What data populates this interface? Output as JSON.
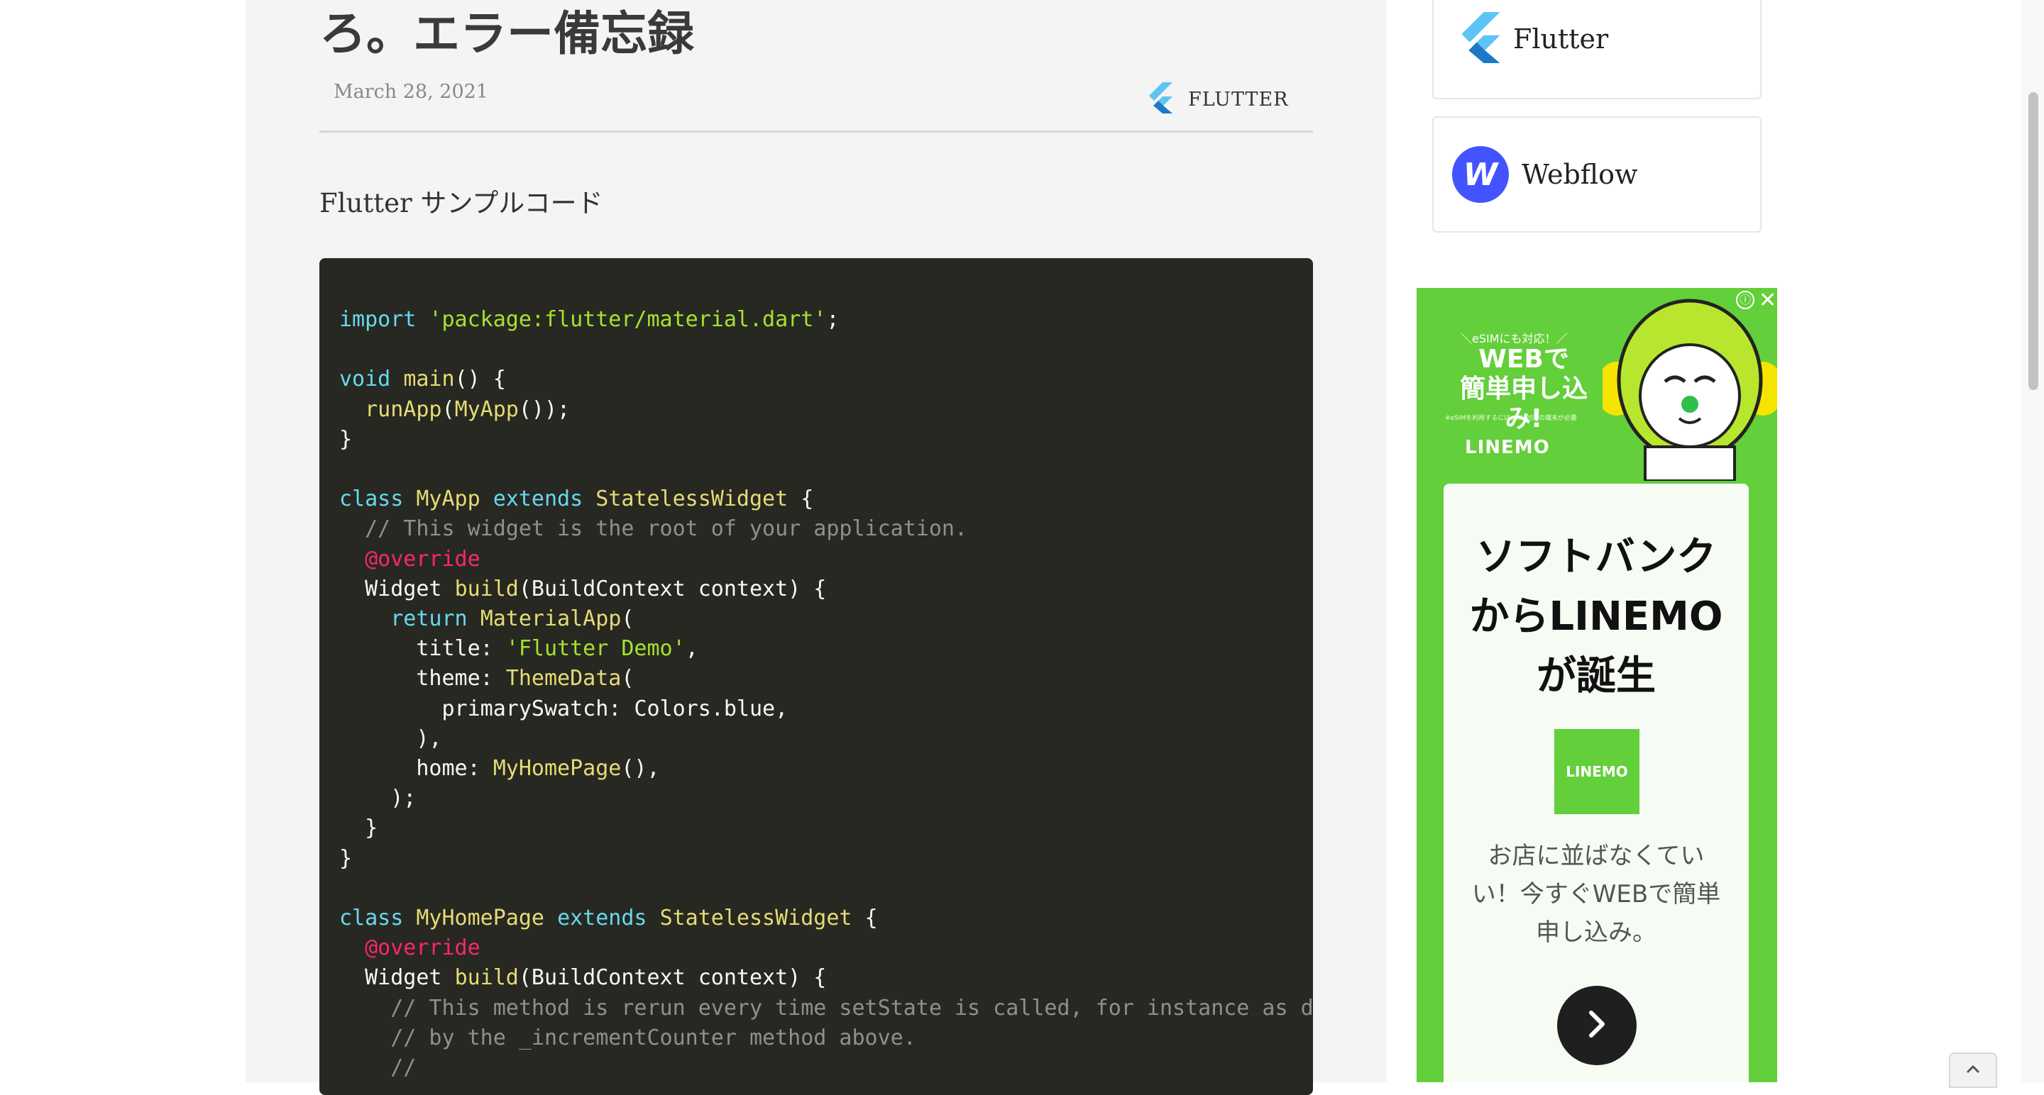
{
  "article": {
    "title": "ろ。エラー備忘録",
    "date": "March 28, 2021",
    "category": "FLUTTER",
    "intro": "Flutter サンプルコード"
  },
  "code": {
    "language": "dart",
    "lines": [
      "import 'package:flutter/material.dart';",
      "",
      "void main() {",
      "  runApp(MyApp());",
      "}",
      "",
      "class MyApp extends StatelessWidget {",
      "  // This widget is the root of your application.",
      "  @override",
      "  Widget build(BuildContext context) {",
      "    return MaterialApp(",
      "      title: 'Flutter Demo',",
      "      theme: ThemeData(",
      "        primarySwatch: Colors.blue,",
      "      ),",
      "      home: MyHomePage(),",
      "    );",
      "  }",
      "}",
      "",
      "class MyHomePage extends StatelessWidget {",
      "  @override",
      "  Widget build(BuildContext context) {",
      "    // This method is rerun every time setState is called, for instance as done",
      "    // by the _incrementCounter method above.",
      "    //"
    ]
  },
  "sidebar": {
    "items": [
      {
        "label": "Flutter",
        "icon": "flutter-icon"
      },
      {
        "label": "Webflow",
        "icon": "webflow-icon"
      }
    ]
  },
  "ad": {
    "kicker": "＼eSIMにも対応！／",
    "top_headline_1": "WEBで",
    "top_headline_2": "簡単申し込み!",
    "fine_print": "※eSIMを利用するにはeSIM対応の端末が必要",
    "brand": "LINEMO",
    "headline": "ソフトバンクからLINEMOが誕生",
    "logo_text": "LINEMO",
    "body": "お店に並ばなくていい！今すぐWEBで簡単申し込み。",
    "info": "ⓘ",
    "close": "✕"
  },
  "colors": {
    "code_bg": "#272822",
    "ad_green": "#63cf3a",
    "webflow_blue": "#4353ff"
  }
}
